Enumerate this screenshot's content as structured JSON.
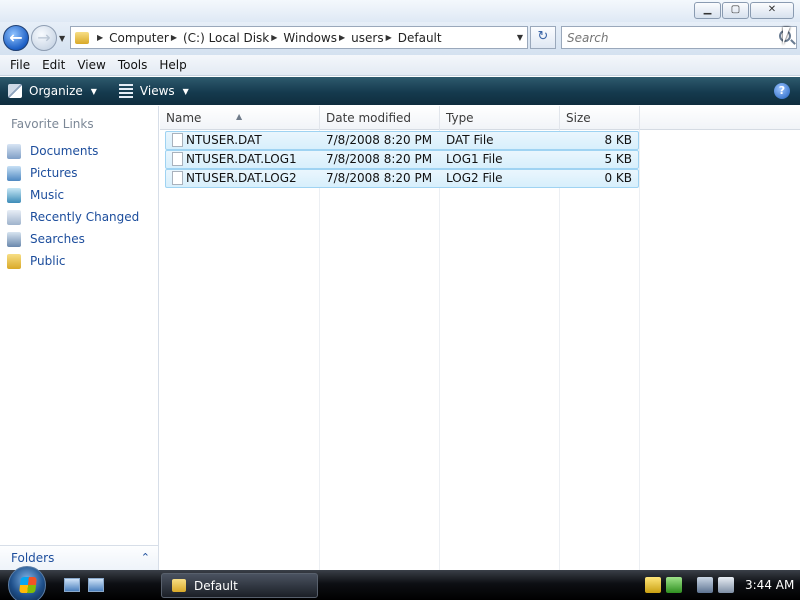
{
  "window": {
    "minimize_glyph": "▁",
    "maximize_glyph": "▢",
    "close_glyph": "✕"
  },
  "nav": {
    "back_glyph": "←",
    "forward_glyph": "→",
    "refresh_glyph": "↻",
    "breadcrumbs": [
      "Computer",
      "(C:) Local Disk",
      "Windows",
      "users",
      "Default"
    ],
    "search_placeholder": "Search"
  },
  "menu": [
    "File",
    "Edit",
    "View",
    "Tools",
    "Help"
  ],
  "toolbar": {
    "organize_label": "Organize",
    "views_label": "Views",
    "help_glyph": "?"
  },
  "sidebar": {
    "title": "Favorite Links",
    "items": [
      {
        "label": "Documents",
        "icon": "documents-icon"
      },
      {
        "label": "Pictures",
        "icon": "pictures-icon"
      },
      {
        "label": "Music",
        "icon": "music-icon"
      },
      {
        "label": "Recently Changed",
        "icon": "recently-changed-icon"
      },
      {
        "label": "Searches",
        "icon": "searches-icon"
      },
      {
        "label": "Public",
        "icon": "public-folder-icon"
      }
    ],
    "folders_label": "Folders",
    "folders_chevron": "⌃"
  },
  "files": {
    "columns": [
      "Name",
      "Date modified",
      "Type",
      "Size"
    ],
    "rows": [
      {
        "name": "NTUSER.DAT",
        "date": "7/8/2008 8:20 PM",
        "type": "DAT File",
        "size": "8 KB"
      },
      {
        "name": "NTUSER.DAT.LOG1",
        "date": "7/8/2008 8:20 PM",
        "type": "LOG1 File",
        "size": "5 KB"
      },
      {
        "name": "NTUSER.DAT.LOG2",
        "date": "7/8/2008 8:20 PM",
        "type": "LOG2 File",
        "size": "0 KB"
      }
    ]
  },
  "taskbar": {
    "window_button_label": "Default",
    "clock": "3:44 AM"
  }
}
